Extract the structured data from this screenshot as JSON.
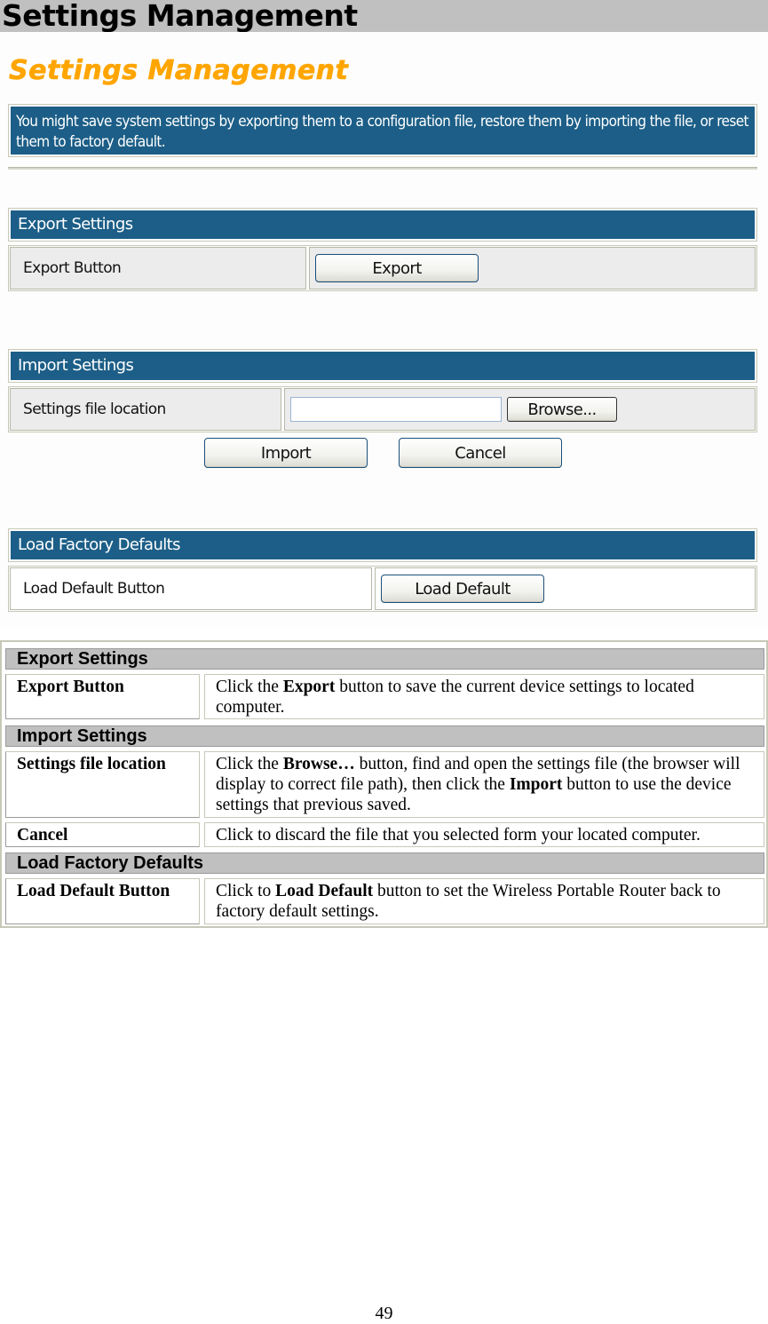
{
  "document": {
    "heading": "Settings Management",
    "page_number": "49"
  },
  "screenshot": {
    "title": "Settings Management",
    "intro": "You might save system settings by exporting them to a configuration file, restore them by importing the file, or reset them to factory default.",
    "export_section": {
      "header": "Export Settings",
      "row_label": "Export Button",
      "button_label": "Export"
    },
    "import_section": {
      "header": "Import Settings",
      "row_label": "Settings file location",
      "file_input_value": "",
      "browse_label": "Browse...",
      "import_label": "Import",
      "cancel_label": "Cancel"
    },
    "factory_section": {
      "header": "Load Factory Defaults",
      "row_label": "Load Default Button",
      "button_label": "Load Default"
    },
    "colors": {
      "title_orange": "#ffa500",
      "header_blue": "#1c5e87"
    }
  },
  "description_table": {
    "sections": [
      {
        "header": "Export Settings",
        "rows": [
          {
            "term": "Export Button",
            "parts": [
              {
                "t": "Click the ",
                "b": false
              },
              {
                "t": "Export",
                "b": true
              },
              {
                "t": " button to save the current device settings to located computer.",
                "b": false
              }
            ]
          }
        ]
      },
      {
        "header": "Import Settings",
        "rows": [
          {
            "term": "Settings file location",
            "parts": [
              {
                "t": "Click the ",
                "b": false
              },
              {
                "t": "Browse…",
                "b": true
              },
              {
                "t": " button, find and open the settings file (the browser will display to correct file path), then click the ",
                "b": false
              },
              {
                "t": "Import",
                "b": true
              },
              {
                "t": " button to use the device settings that previous saved.",
                "b": false
              }
            ]
          },
          {
            "term": "Cancel",
            "parts": [
              {
                "t": "Click to discard the file that you selected form your located computer.",
                "b": false
              }
            ]
          }
        ]
      },
      {
        "header": "Load Factory Defaults",
        "rows": [
          {
            "term": "Load Default Button",
            "parts": [
              {
                "t": "Click to ",
                "b": false
              },
              {
                "t": "Load Default",
                "b": true
              },
              {
                "t": " button to set the Wireless Portable Router back to factory default settings.",
                "b": false
              }
            ]
          }
        ]
      }
    ]
  }
}
